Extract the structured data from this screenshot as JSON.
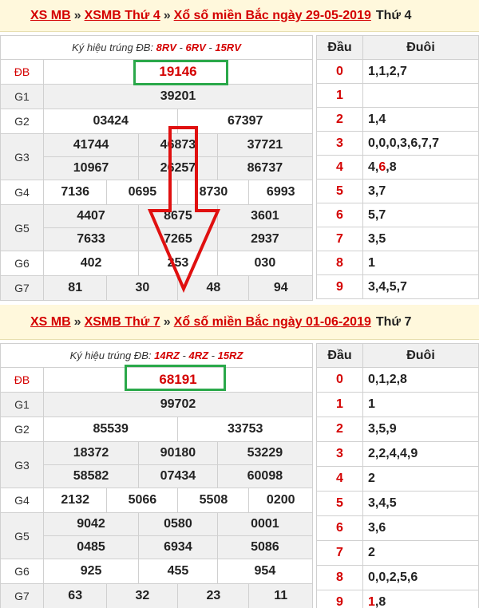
{
  "draw1": {
    "header": {
      "xs": "XS MB",
      "xsmb": "XSMB Thứ 4",
      "xo": "Xổ số miền Bắc ngày 29-05-2019",
      "day": "Thứ 4",
      "sep": "»"
    },
    "symbol_label": "Ký hiệu trúng ĐB:",
    "symbols": [
      "8RV",
      "6RV",
      "15RV"
    ],
    "sym_sep": " - ",
    "prizes": {
      "DB": "19146",
      "G1": "39201",
      "G2": [
        "03424",
        "67397"
      ],
      "G3": [
        "41744",
        "46873",
        "37721",
        "10967",
        "26257",
        "86737"
      ],
      "G4": [
        "7136",
        "0695",
        "8730",
        "6993"
      ],
      "G5": [
        "4407",
        "8675",
        "3601",
        "7633",
        "7265",
        "2937"
      ],
      "G6": [
        "402",
        "253",
        "030"
      ],
      "G7": [
        "81",
        "30",
        "48",
        "94"
      ]
    },
    "labels": {
      "DB": "ĐB",
      "G1": "G1",
      "G2": "G2",
      "G3": "G3",
      "G4": "G4",
      "G5": "G5",
      "G6": "G6",
      "G7": "G7"
    },
    "loto_head": "Đầu",
    "loto_tail": "Đuôi",
    "loto": [
      {
        "h": "0",
        "t": "1,1,2,7"
      },
      {
        "h": "1",
        "t": ""
      },
      {
        "h": "2",
        "t": "1,4"
      },
      {
        "h": "3",
        "t": "0,0,0,3,6,7,7"
      },
      {
        "h": "4",
        "t_pre": "4,",
        "t_red": "6",
        "t_post": ",8"
      },
      {
        "h": "5",
        "t": "3,7"
      },
      {
        "h": "6",
        "t": "5,7"
      },
      {
        "h": "7",
        "t": "3,5"
      },
      {
        "h": "8",
        "t": "1"
      },
      {
        "h": "9",
        "t": "3,4,5,7"
      }
    ]
  },
  "draw2": {
    "header": {
      "xs": "XS MB",
      "xsmb": "XSMB Thứ 7",
      "xo": "Xổ số miền Bắc ngày 01-06-2019",
      "day": "Thứ 7",
      "sep": "»"
    },
    "symbol_label": "Ký hiệu trúng ĐB:",
    "symbols": [
      "14RZ",
      "4RZ",
      "15RZ"
    ],
    "sym_sep": " - ",
    "prizes": {
      "DB": "68191",
      "G1": "99702",
      "G2": [
        "85539",
        "33753"
      ],
      "G3": [
        "18372",
        "90180",
        "53229",
        "58582",
        "07434",
        "60098"
      ],
      "G4": [
        "2132",
        "5066",
        "5508",
        "0200"
      ],
      "G5": [
        "9042",
        "0580",
        "0001",
        "0485",
        "6934",
        "5086"
      ],
      "G6": [
        "925",
        "455",
        "954"
      ],
      "G7": [
        "63",
        "32",
        "23",
        "11"
      ]
    },
    "labels": {
      "DB": "ĐB",
      "G1": "G1",
      "G2": "G2",
      "G3": "G3",
      "G4": "G4",
      "G5": "G5",
      "G6": "G6",
      "G7": "G7"
    },
    "loto_head": "Đầu",
    "loto_tail": "Đuôi",
    "loto": [
      {
        "h": "0",
        "t": "0,1,2,8"
      },
      {
        "h": "1",
        "t": "1"
      },
      {
        "h": "2",
        "t": "3,5,9"
      },
      {
        "h": "3",
        "t": "2,2,4,4,9"
      },
      {
        "h": "4",
        "t": "2"
      },
      {
        "h": "5",
        "t": "3,4,5"
      },
      {
        "h": "6",
        "t": "3,6"
      },
      {
        "h": "7",
        "t": "2"
      },
      {
        "h": "8",
        "t": "0,0,2,5,6"
      },
      {
        "h": "9",
        "t_red": "1",
        "t_post": ",8"
      }
    ]
  },
  "colors": {
    "accent": "#d40000",
    "highlight_box": "#2aa84a",
    "arrow": "#e01010",
    "header_bg": "#fff8dc"
  }
}
